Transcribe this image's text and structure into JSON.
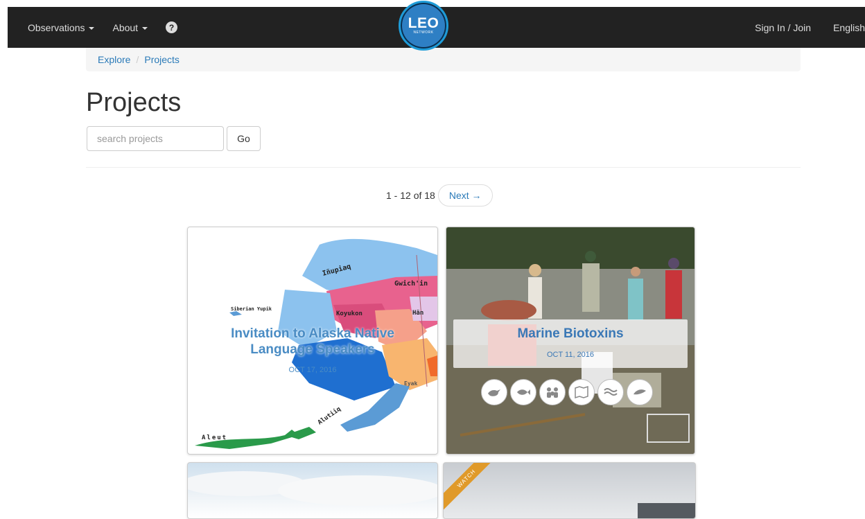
{
  "nav": {
    "observations": "Observations",
    "about": "About",
    "help": "?",
    "sign_in": "Sign In / Join",
    "language": "English"
  },
  "logo": {
    "main": "LEO",
    "sub": "NETWORK"
  },
  "breadcrumb": {
    "explore": "Explore",
    "sep": "/",
    "projects": "Projects"
  },
  "page": {
    "title": "Projects"
  },
  "search": {
    "placeholder": "search projects",
    "go_label": "Go"
  },
  "pagination": {
    "summary": "1 - 12 of 18",
    "next": "Next →"
  },
  "projects": [
    {
      "title": "Invitation to Alaska Native Language Speakers",
      "date": "OCT 17, 2016",
      "map_labels": [
        "Iñupiaq",
        "Gwich'in",
        "Siberian Yupik",
        "Koyukon",
        "Hän",
        "Aleut",
        "Alutiiq",
        "Eyak"
      ]
    },
    {
      "title": "Marine Biotoxins",
      "date": "OCT 11, 2016",
      "icons": [
        "bird-icon",
        "fish-icon",
        "people-icon",
        "map-icon",
        "water-icon",
        "marine-mammal-icon"
      ]
    },
    {
      "title": "",
      "date": ""
    },
    {
      "badge": "WATCH"
    }
  ],
  "colors": {
    "nav_bg": "#222222",
    "link": "#2a7ab8",
    "logo": "#2e7fc4",
    "ribbon": "#e09a2a"
  }
}
